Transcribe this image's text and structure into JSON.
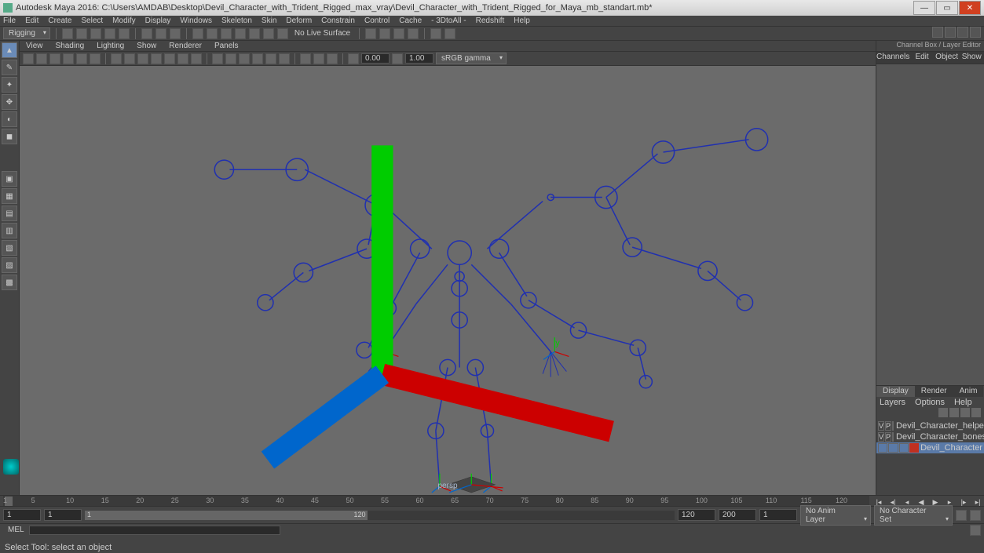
{
  "title": "Autodesk Maya 2016: C:\\Users\\AMDAB\\Desktop\\Devil_Character_with_Trident_Rigged_max_vray\\Devil_Character_with_Trident_Rigged_for_Maya_mb_standart.mb*",
  "menubar": [
    "File",
    "Edit",
    "Create",
    "Select",
    "Modify",
    "Display",
    "Windows",
    "Skeleton",
    "Skin",
    "Deform",
    "Constrain",
    "Control",
    "Cache",
    "- 3DtoAll -",
    "Redshift",
    "Help"
  ],
  "workspace_mode": "Rigging",
  "surface_mode": "No Live Surface",
  "panelmenu": [
    "View",
    "Shading",
    "Lighting",
    "Show",
    "Renderer",
    "Panels"
  ],
  "exposure": "0.00",
  "gamma": "1.00",
  "color_space": "sRGB gamma",
  "camera": "persp",
  "channelbox_title": "Channel Box / Layer Editor",
  "channel_tabs": [
    "Channels",
    "Edit",
    "Object",
    "Show"
  ],
  "layer_tabs": [
    "Display",
    "Render",
    "Anim"
  ],
  "layer_menu": [
    "Layers",
    "Options",
    "Help"
  ],
  "layers": [
    {
      "v": "V",
      "p": "P",
      "color": "#2040e0",
      "name": "Devil_Character_helpe"
    },
    {
      "v": "V",
      "p": "P",
      "color": "#2040e0",
      "name": "Devil_Character_bones"
    },
    {
      "v": "",
      "p": "",
      "color": "#c03020",
      "name": "Devil_Character",
      "selected": true
    }
  ],
  "timeline": {
    "ticks": [
      1,
      5,
      10,
      15,
      20,
      25,
      30,
      35,
      40,
      45,
      50,
      55,
      60,
      65,
      70,
      75,
      80,
      85,
      90,
      95,
      100,
      105,
      110,
      115,
      120
    ],
    "current": 1
  },
  "range": {
    "start": "1",
    "disp_start": "1",
    "disp_end": "120",
    "end": "200",
    "current": "1"
  },
  "anim_layer": "No Anim Layer",
  "char_set": "No Character Set",
  "cmd_lang": "MEL",
  "status": "Select Tool: select an object"
}
